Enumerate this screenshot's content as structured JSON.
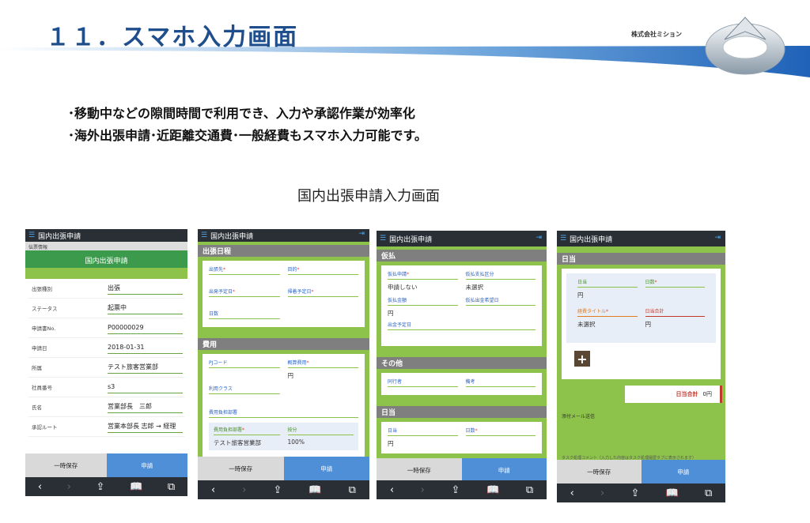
{
  "header": {
    "title": "１１．スマホ入力画面",
    "company": "株式会社ミション"
  },
  "bullets": [
    "･移動中などの隙間時間で利用でき、入力や承認作業が効率化",
    "･海外出張申請･近距離交通費･一般経費もスマホ入力可能です。"
  ],
  "subtitle": "国内出張申請入力画面",
  "common": {
    "app_title": "国内出張申請",
    "save_label": "一時保存",
    "apply_label": "申請",
    "menu_icon": "☰",
    "exit_icon": "⇥",
    "nav": {
      "back": "‹",
      "forward": "›",
      "share": "⇪",
      "bookmarks": "📖",
      "tabs": "⧉"
    }
  },
  "phone1": {
    "sub_header": "伝票情報",
    "section_title": "国内出張申請",
    "rows": [
      {
        "label": "出張種別",
        "value": "出張"
      },
      {
        "label": "ステータス",
        "value": "起票中"
      },
      {
        "label": "申請書No.",
        "value": "P00000029"
      },
      {
        "label": "申請日",
        "value": "2018-01-31"
      },
      {
        "label": "所属",
        "value": "テスト旅客営業部"
      },
      {
        "label": "社員番号",
        "value": "s3"
      },
      {
        "label": "氏名",
        "value": "営業部長　三郎"
      },
      {
        "label": "承認ルート",
        "value": "営業本部長 志郎 → 経理"
      }
    ]
  },
  "phone2": {
    "section1": "出張日程",
    "fields1": [
      {
        "label": "出張先",
        "value": ""
      },
      {
        "label": "目的",
        "value": ""
      },
      {
        "label": "出発予定日",
        "value": ""
      },
      {
        "label": "帰着予定日",
        "value": ""
      },
      {
        "label": "日数",
        "value": ""
      }
    ],
    "section2": "費用",
    "fields2": [
      {
        "label": "PJコード",
        "value": ""
      },
      {
        "label": "概算費用",
        "value": "円"
      },
      {
        "label": "利用クラス",
        "value": ""
      }
    ],
    "burden_title": "費用負担部署",
    "burden_dept_label": "費用負担部署",
    "burden_dept_value": "テスト旅客営業部",
    "burden_ratio_label": "按分",
    "burden_ratio_value": "100%"
  },
  "phone3": {
    "section1": "仮払",
    "fields1": [
      {
        "label": "仮払申請",
        "value": "申請しない"
      },
      {
        "label": "仮払支払区分",
        "value": "未選択"
      },
      {
        "label": "仮払金額",
        "value": "円"
      },
      {
        "label": "仮払出金希望日",
        "value": ""
      },
      {
        "label": "出金予定日",
        "value": ""
      }
    ],
    "section2": "その他",
    "fields2": [
      {
        "label": "同行者",
        "value": ""
      },
      {
        "label": "備考",
        "value": ""
      }
    ],
    "section3": "日当",
    "fields3": [
      {
        "label": "日当",
        "value": "円"
      },
      {
        "label": "日数",
        "value": ""
      }
    ]
  },
  "phone4": {
    "section1": "日当",
    "fields": [
      {
        "label": "日当",
        "value": "円"
      },
      {
        "label": "日数",
        "value": ""
      },
      {
        "label": "経費タイトル",
        "value": "未選択"
      },
      {
        "label": "日当合計",
        "value": "円"
      }
    ],
    "plus": "+",
    "total_label": "日当合計",
    "total_value": "0円",
    "mail_label": "添付メール送信",
    "comment_label": "タスク処理コメント（入力した内容はタスク処理履歴タブに表示されます）"
  }
}
